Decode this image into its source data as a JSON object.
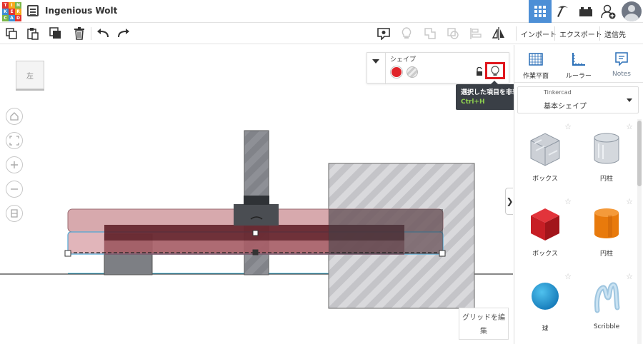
{
  "header": {
    "logo_letters": [
      "T",
      "I",
      "N",
      "K",
      "E",
      "R",
      "C",
      "A",
      "D"
    ],
    "logo_colors": [
      "#e3342f",
      "#f7a71b",
      "#7ab648",
      "#3d8ed4",
      "#e3342f",
      "#f7a71b",
      "#7ab648",
      "#3d8ed4",
      "#e3342f"
    ],
    "title": "Ingenious Wolt",
    "right_icons": [
      "grid-view-icon",
      "pickaxe-icon",
      "lego-brick-icon",
      "add-user-icon",
      "avatar"
    ]
  },
  "toolbar": {
    "left_icons": [
      "copy-icon",
      "paste-icon",
      "duplicate-icon",
      "delete-icon",
      "undo-icon",
      "redo-icon"
    ],
    "right_icons": [
      "notes-balloon-icon",
      "lightbulb-icon",
      "group-icon",
      "ungroup-icon",
      "align-icon",
      "mirror-icon"
    ],
    "import_label": "インポート",
    "export_label": "エクスポート",
    "send_label": "送信先"
  },
  "workspace": {
    "viewcube_label": "左",
    "nav_icons": [
      "home-icon",
      "fit-view-icon",
      "zoom-in-icon",
      "zoom-out-icon",
      "perspective-icon"
    ],
    "grid_edit_label": "グリッドを編集",
    "collapse_glyph": "❯"
  },
  "inspector": {
    "label": "シェイプ",
    "solid_color": "#e0242a",
    "tooltip_title": "選択した項目を非表示",
    "tooltip_shortcut": "Ctrl+H"
  },
  "panel": {
    "tabs": [
      {
        "label": "作業平面",
        "icon": "workplane-icon"
      },
      {
        "label": "ルーラー",
        "icon": "ruler-icon"
      },
      {
        "label": "Notes",
        "icon": "notes-icon"
      }
    ],
    "dropdown_category": "Tinkercad",
    "dropdown_value": "基本シェイプ",
    "shapes": [
      {
        "name": "ボックス",
        "style": "transparent-box"
      },
      {
        "name": "円柱",
        "style": "transparent-cylinder"
      },
      {
        "name": "ボックス",
        "style": "red-box"
      },
      {
        "name": "円柱",
        "style": "orange-cylinder"
      },
      {
        "name": "球",
        "style": "blue-sphere"
      },
      {
        "name": "Scribble",
        "style": "scribble"
      }
    ]
  }
}
